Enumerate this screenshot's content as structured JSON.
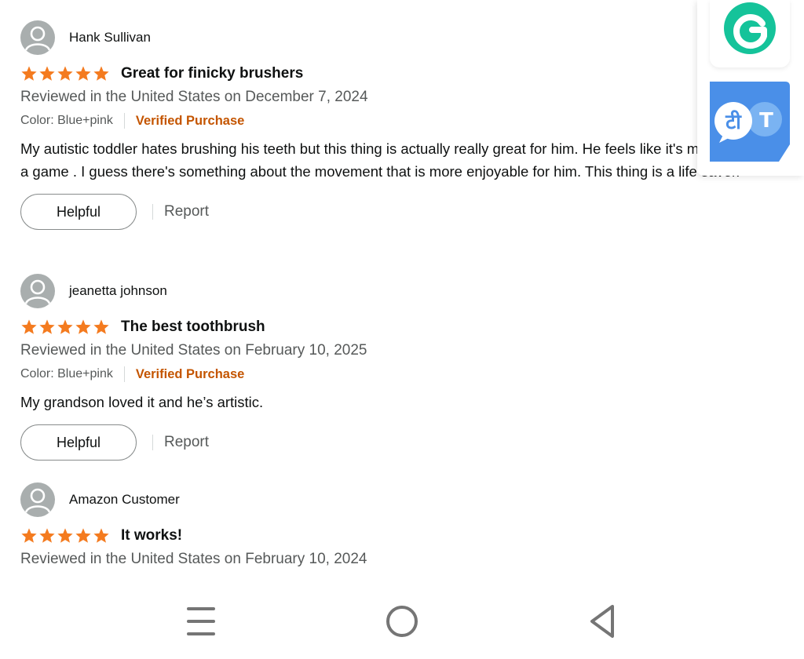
{
  "reviews": [
    {
      "name": "Hank Sullivan",
      "rating": 5,
      "title": "Great for finicky brushers",
      "date": "Reviewed in the United States on December 7, 2024",
      "color": "Color: Blue+pink",
      "verified": "Verified Purchase",
      "body": "My autistic toddler hates brushing his teeth but this thing is actually really great for him. He feels like it's more of a game . I guess there's something about the movement that is more enjoyable for him. This thing is a life saver.",
      "helpful_label": "Helpful",
      "report_label": "Report"
    },
    {
      "name": "jeanetta johnson",
      "rating": 5,
      "title": "The best toothbrush",
      "date": "Reviewed in the United States on February 10, 2025",
      "color": "Color: Blue+pink",
      "verified": "Verified Purchase",
      "body": "My grandson loved it and he’s artistic.",
      "helpful_label": "Helpful",
      "report_label": "Report"
    },
    {
      "name": "Amazon Customer",
      "rating": 5,
      "title": "It works!",
      "date": "Reviewed in the United States on February 10, 2024"
    }
  ],
  "extensions": {
    "grammarly_icon": "grammarly-icon",
    "translate_icon": "translate-icon",
    "translate_glyph_left": "टी",
    "translate_glyph_right": "T"
  },
  "nav": {
    "recents_icon": "menu-icon",
    "home_icon": "home-circle-icon",
    "back_icon": "back-triangle-icon"
  },
  "colors": {
    "star": "#f47b1f",
    "verified": "#c45500",
    "grammarly": "#15c39a",
    "translate": "#4a8fe8"
  }
}
